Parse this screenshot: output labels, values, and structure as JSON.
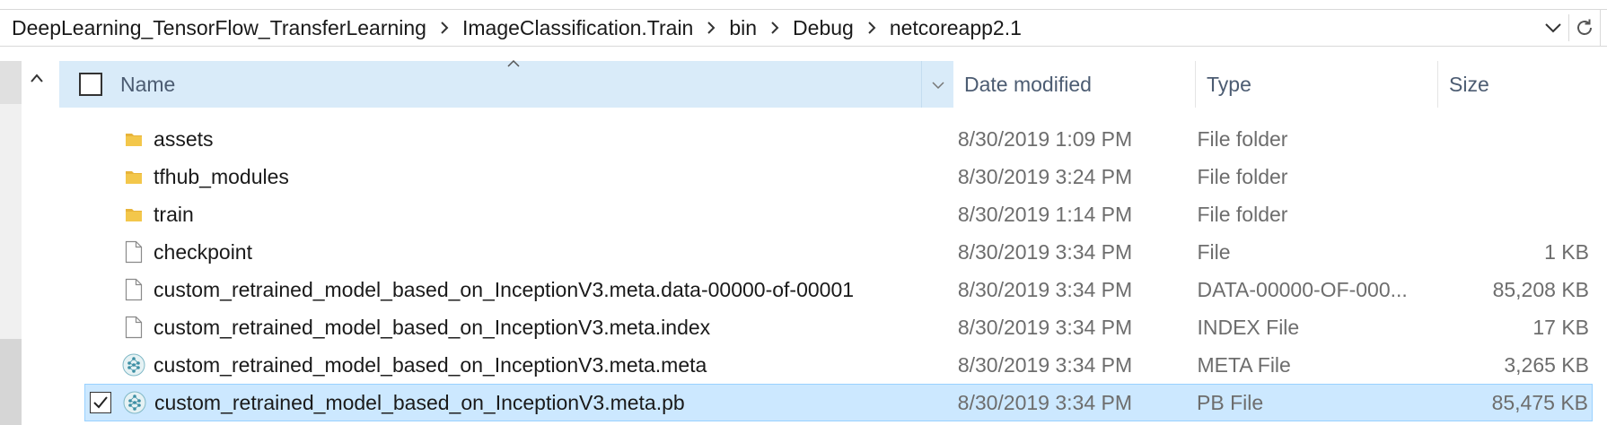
{
  "breadcrumb": {
    "items": [
      "DeepLearning_TensorFlow_TransferLearning",
      "ImageClassification.Train",
      "bin",
      "Debug",
      "netcoreapp2.1"
    ],
    "separator_icon": "chevron-right-icon",
    "dropdown_icon": "chevron-down-icon",
    "refresh_icon": "refresh-icon"
  },
  "columns": {
    "name": "Name",
    "date": "Date modified",
    "type": "Type",
    "size": "Size"
  },
  "files": [
    {
      "name": "assets",
      "date": "8/30/2019 1:09 PM",
      "type": "File folder",
      "size": "",
      "icon": "folder-icon",
      "selected": false
    },
    {
      "name": "tfhub_modules",
      "date": "8/30/2019 3:24 PM",
      "type": "File folder",
      "size": "",
      "icon": "folder-icon",
      "selected": false
    },
    {
      "name": "train",
      "date": "8/30/2019 1:14 PM",
      "type": "File folder",
      "size": "",
      "icon": "folder-icon",
      "selected": false
    },
    {
      "name": "checkpoint",
      "date": "8/30/2019 3:34 PM",
      "type": "File",
      "size": "1 KB",
      "icon": "file-icon",
      "selected": false
    },
    {
      "name": "custom_retrained_model_based_on_InceptionV3.meta.data-00000-of-00001",
      "date": "8/30/2019 3:34 PM",
      "type": "DATA-00000-OF-000...",
      "size": "85,208 KB",
      "icon": "file-icon",
      "selected": false
    },
    {
      "name": "custom_retrained_model_based_on_InceptionV3.meta.index",
      "date": "8/30/2019 3:34 PM",
      "type": "INDEX File",
      "size": "17 KB",
      "icon": "file-icon",
      "selected": false
    },
    {
      "name": "custom_retrained_model_based_on_InceptionV3.meta.meta",
      "date": "8/30/2019 3:34 PM",
      "type": "META File",
      "size": "3,265 KB",
      "icon": "netron-icon",
      "selected": false
    },
    {
      "name": "custom_retrained_model_based_on_InceptionV3.meta.pb",
      "date": "8/30/2019 3:34 PM",
      "type": "PB File",
      "size": "85,475 KB",
      "icon": "netron-icon",
      "selected": true
    }
  ],
  "colors": {
    "header_hover": "#d9ebf9",
    "selection_bg": "#cce8ff",
    "selection_border": "#99d1ff",
    "folder": "#f3c74b"
  }
}
